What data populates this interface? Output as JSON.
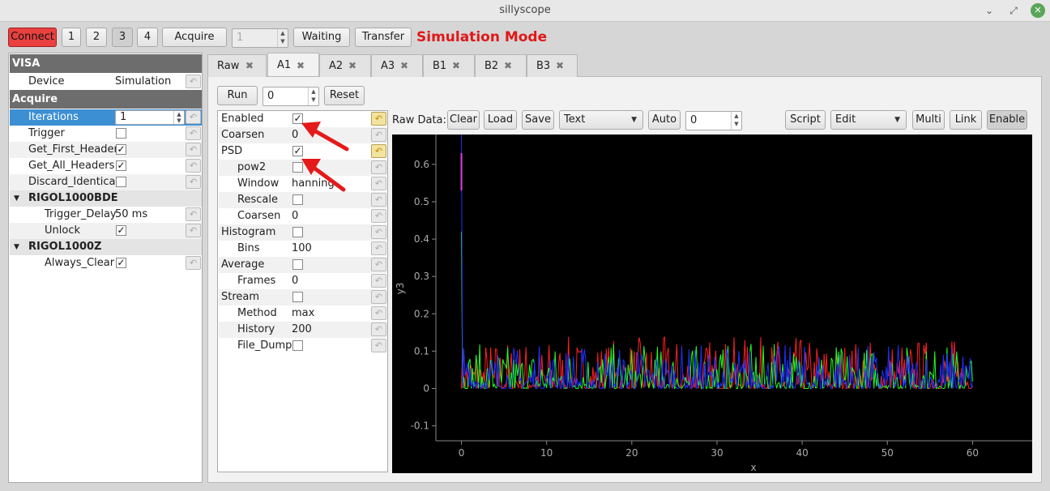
{
  "window": {
    "title": "sillyscope"
  },
  "toolbar": {
    "connect": "Connect",
    "ch1": "1",
    "ch2": "2",
    "ch3": "3",
    "ch4": "4",
    "acquire": "Acquire",
    "acquire_count": "1",
    "waiting": "Waiting",
    "transfer": "Transfer",
    "mode_text": "Simulation Mode"
  },
  "left_tree": {
    "visa_header": "VISA",
    "device_label": "Device",
    "device_value": "Simulation",
    "acquire_header": "Acquire",
    "iterations_label": "Iterations",
    "iterations_value": "1",
    "trigger_label": "Trigger",
    "get_first_header_label": "Get_First_Header",
    "get_all_headers_label": "Get_All_Headers",
    "discard_identical_label": "Discard_Identical",
    "rigol_bde_label": "RIGOL1000BDE",
    "trigger_delay_label": "Trigger_Delay",
    "trigger_delay_value": "50 ms",
    "unlock_label": "Unlock",
    "rigol_z_label": "RIGOL1000Z",
    "always_clear_label": "Always_Clear",
    "checks": {
      "trigger": false,
      "get_first_header": true,
      "get_all_headers": true,
      "discard_identical": false,
      "unlock": true,
      "always_clear": true
    }
  },
  "tabs": [
    "Raw",
    "A1",
    "A2",
    "A3",
    "B1",
    "B2",
    "B3"
  ],
  "active_tab": "A1",
  "tab_panel": {
    "run": "Run",
    "run_value": "0",
    "reset": "Reset"
  },
  "settings": {
    "enabled": "Enabled",
    "coarsen": "Coarsen",
    "coarsen_value": "0",
    "psd": "PSD",
    "pow2": "pow2",
    "window": "Window",
    "window_value": "hanning",
    "rescale": "Rescale",
    "coarsen2": "Coarsen",
    "coarsen2_value": "0",
    "histogram": "Histogram",
    "bins": "Bins",
    "bins_value": "100",
    "average": "Average",
    "frames": "Frames",
    "frames_value": "0",
    "stream": "Stream",
    "method": "Method",
    "method_value": "max",
    "history": "History",
    "history_value": "200",
    "file_dump": "File_Dump"
  },
  "plot_toolbar": {
    "raw_data_label": "Raw Data:",
    "clear": "Clear",
    "load": "Load",
    "save": "Save",
    "format": "Text",
    "auto": "Auto",
    "auto_value": "0",
    "script": "Script",
    "edit": "Edit",
    "multi": "Multi",
    "link": "Link",
    "enable": "Enable"
  },
  "chart_data": {
    "type": "line",
    "xlabel": "x",
    "ylabel": "y3",
    "xlim": [
      -3,
      67
    ],
    "ylim": [
      -0.14,
      0.68
    ],
    "xticks": [
      0,
      10,
      20,
      30,
      40,
      50,
      60
    ],
    "yticks": [
      -0.1,
      0,
      0.1,
      0.2,
      0.3,
      0.4,
      0.5,
      0.6
    ],
    "ytick_labels": [
      "-0.1",
      "0",
      "0.1",
      "0.2",
      "0.3",
      "0.4",
      "0.5",
      "0.6"
    ],
    "grid": false,
    "series": [
      {
        "color": "#ff2020",
        "noise_max": 0.14,
        "spike": 0.0
      },
      {
        "color": "#20ff20",
        "noise_max": 0.12,
        "spike": 0.42
      },
      {
        "color": "#2030ff",
        "noise_max": 0.12,
        "spike": 0.68
      }
    ],
    "x_range": [
      0,
      60
    ],
    "spike_magenta_range": [
      0.53,
      0.63
    ]
  }
}
